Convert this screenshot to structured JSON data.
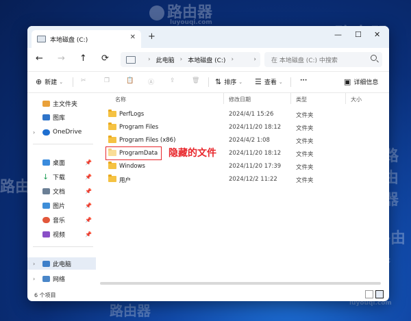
{
  "tab": {
    "title": "本地磁盘 (C:)",
    "close": "✕",
    "new": "+"
  },
  "window_controls": {
    "minimize": "—",
    "maximize": "☐",
    "close": "✕"
  },
  "nav": {
    "back": "←",
    "forward": "→",
    "up": "↑",
    "refresh": "⟳"
  },
  "address": {
    "crumb1": "此电脑",
    "separator": "›",
    "crumb2": "本地磁盘 (C:)",
    "chevron": "›"
  },
  "search": {
    "placeholder": "在 本地磁盘 (C:) 中搜索"
  },
  "toolbar": {
    "new_label": "新建",
    "sort_label": "排序",
    "view_label": "查看",
    "more_label": "···",
    "details_label": "详细信息"
  },
  "sidebar": {
    "items": [
      {
        "label": "主文件夹"
      },
      {
        "label": "图库"
      },
      {
        "label": "OneDrive"
      },
      {
        "label": "桌面"
      },
      {
        "label": "下载"
      },
      {
        "label": "文档"
      },
      {
        "label": "图片"
      },
      {
        "label": "音乐"
      },
      {
        "label": "视频"
      },
      {
        "label": "此电脑"
      },
      {
        "label": "网络"
      }
    ]
  },
  "columns": {
    "name": "名称",
    "date": "修改日期",
    "type": "类型",
    "size": "大小"
  },
  "files": [
    {
      "name": "PerfLogs",
      "date": "2024/4/1 15:26",
      "type": "文件夹"
    },
    {
      "name": "Program Files",
      "date": "2024/11/20 18:12",
      "type": "文件夹"
    },
    {
      "name": "Program Files (x86)",
      "date": "2024/4/2 1:08",
      "type": "文件夹"
    },
    {
      "name": "ProgramData",
      "date": "2024/11/20 18:12",
      "type": "文件夹"
    },
    {
      "name": "Windows",
      "date": "2024/11/20 17:39",
      "type": "文件夹"
    },
    {
      "name": "用户",
      "date": "2024/12/2 11:22",
      "type": "文件夹"
    }
  ],
  "annotation": {
    "text": "隐藏的文件",
    "color": "#e8262b"
  },
  "status": {
    "count": "6 个项目"
  },
  "watermark": {
    "brand": "路由器",
    "url": "luyouqi.com"
  }
}
